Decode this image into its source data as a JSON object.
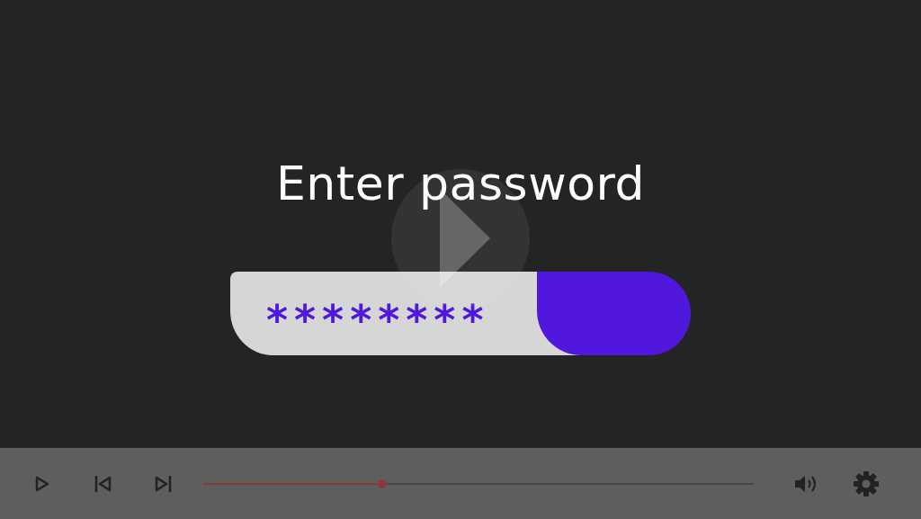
{
  "video": {
    "title": "Enter password",
    "password_field": {
      "value": "********"
    }
  },
  "controls": {
    "progress": {
      "level": 0.325
    }
  }
}
